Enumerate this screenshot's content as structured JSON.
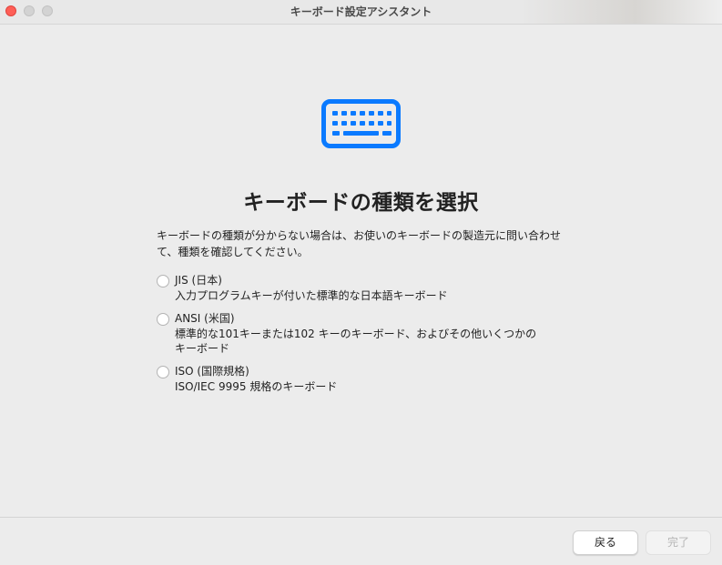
{
  "window": {
    "title": "キーボード設定アシスタント"
  },
  "main": {
    "icon": "keyboard-icon",
    "heading": "キーボードの種類を選択",
    "description_line1": "キーボードの種類が分からない場合は、お使いのキーボードの製造元に問い合わせ",
    "description_line2": "て、種類を確認してください。",
    "options": [
      {
        "title": "JIS (日本)",
        "desc_line1": "入力プログラムキーが付いた標準的な日本語キーボード",
        "desc_line2": ""
      },
      {
        "title": "ANSI (米国)",
        "desc_line1": "標準的な101キーまたは102 キーのキーボード、およびその他いくつかの",
        "desc_line2": "キーボード"
      },
      {
        "title": "ISO (国際規格)",
        "desc_line1": "ISO/IEC 9995 規格のキーボード",
        "desc_line2": ""
      }
    ]
  },
  "footer": {
    "back_label": "戻る",
    "done_label": "完了"
  },
  "colors": {
    "accent": "#0a7aff",
    "close": "#fe5f57"
  }
}
